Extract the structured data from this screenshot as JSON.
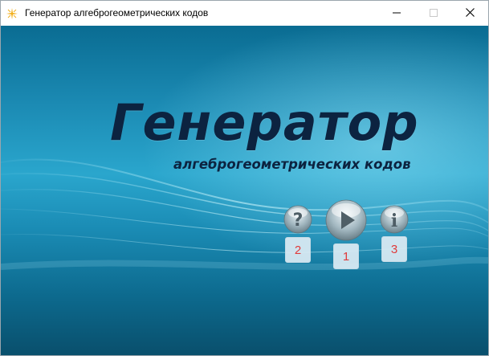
{
  "window": {
    "title": "Генератор алгеброгеометрических кодов",
    "app_icon": "sparkle-icon",
    "controls": [
      "minimize-icon",
      "maximize-icon",
      "close-icon"
    ]
  },
  "splash": {
    "title": "Генератор",
    "subtitle": "алгеброгеометрических кодов"
  },
  "buttons": [
    {
      "name": "help-button",
      "icon": "question-icon"
    },
    {
      "name": "play-button",
      "icon": "play-icon"
    },
    {
      "name": "info-button",
      "icon": "info-icon"
    }
  ],
  "hotkeys": {
    "help": "2",
    "play": "1",
    "info": "3"
  },
  "colors": {
    "background": "#1a8bb4",
    "title_text": "#0c2340",
    "hotkey_text": "#e03a3a"
  }
}
